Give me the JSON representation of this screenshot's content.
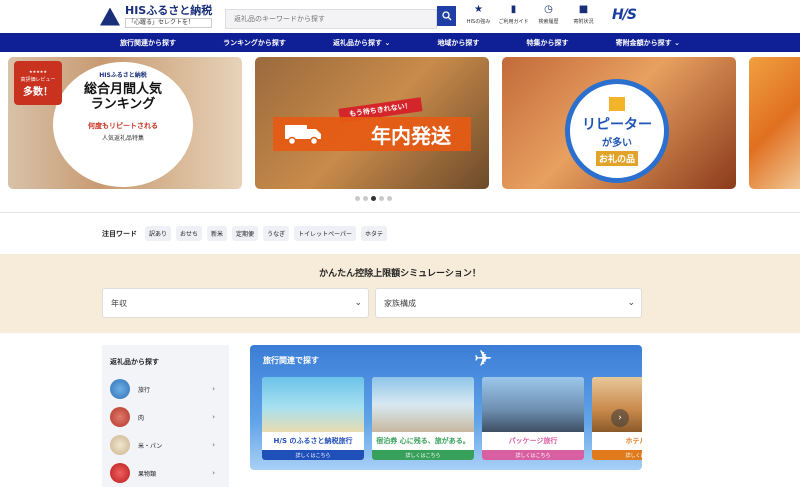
{
  "header": {
    "logo_title": "HISふるさと納税",
    "logo_sub": "「心躍る」セレクトを！",
    "search_placeholder": "返礼品のキーワードから探す",
    "utils": [
      {
        "icon": "star-icon",
        "label": "HISの強み"
      },
      {
        "icon": "book-icon",
        "label": "ご利用ガイド"
      },
      {
        "icon": "history-icon",
        "label": "検索履歴"
      },
      {
        "icon": "bag-icon",
        "label": "寄附状況"
      }
    ],
    "brand": "H/S"
  },
  "nav": {
    "items": [
      "旅行関連から探す",
      "ランキングから探す",
      "返礼品から探す ⌄",
      "地域から探す",
      "特集から探す",
      "寄附金額から探す ⌄"
    ]
  },
  "banners": {
    "b1": {
      "badge_stars": "★★★★★",
      "badge_t1": "高評価レビュー",
      "badge_t2": "多数！",
      "logo": "HISふるさと納税",
      "title_l1": "総合月間人気",
      "title_l2": "ランキング",
      "sub1": "何度もリピートされる",
      "sub2": "人気返礼品特集"
    },
    "b2": {
      "ribbon": "もう待ちきれない！",
      "main": "年内発送"
    },
    "b3": {
      "t1": "リピーター",
      "t2": "が多い",
      "t3": "お礼の品"
    },
    "active_dot": 2,
    "dot_count": 5
  },
  "trend": {
    "label": "注目ワード",
    "chips": [
      "訳あり",
      "おせち",
      "新米",
      "定期便",
      "うなぎ",
      "トイレットペーパー",
      "ホタテ"
    ]
  },
  "simulation": {
    "title": "かんたん控除上限額シミュレーション！",
    "select1": "年収",
    "select2": "家族構成"
  },
  "sidebar": {
    "title": "返礼品から探す",
    "items": [
      {
        "label": "旅行",
        "color": "#3f82c9"
      },
      {
        "label": "肉",
        "color": "#c8473a"
      },
      {
        "label": "米・パン",
        "color": "#d9c7a8"
      },
      {
        "label": "果物類",
        "color": "#d12c2c"
      }
    ]
  },
  "travel": {
    "title": "旅行関連で探す",
    "cards": [
      {
        "label": "H/S のふるさと納税旅行",
        "button": "詳しくはこちら",
        "accent": "#1f4fb8"
      },
      {
        "label": "宿泊券 心に残る、旅がある。",
        "button": "詳しくはこちら",
        "accent": "#37a05a"
      },
      {
        "label": "パッケージ旅行",
        "button": "詳しくはこちら",
        "accent": "#d95fa3"
      },
      {
        "label": "ホテル食事",
        "button": "詳しくはこちら",
        "accent": "#e07a1c"
      }
    ]
  }
}
